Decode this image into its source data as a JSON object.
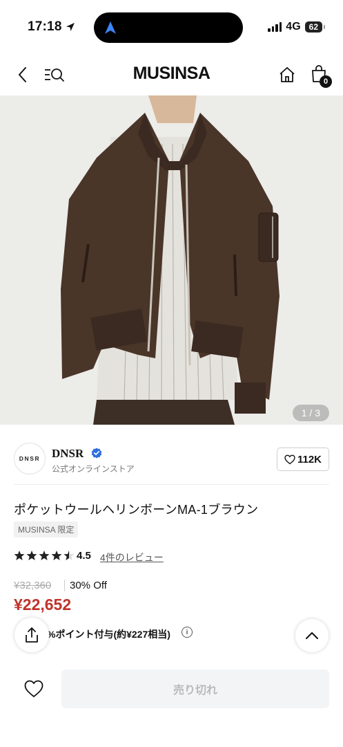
{
  "status_bar": {
    "time": "17:18",
    "network": "4G",
    "battery": "62"
  },
  "header": {
    "logo": "MUSINSA",
    "cart_count": "0",
    "icons": [
      "back-arrow-icon",
      "menu-search-icon",
      "home-icon",
      "cart-icon"
    ]
  },
  "gallery": {
    "counter": "1 / 3",
    "current": 1,
    "total": 3
  },
  "brand": {
    "logo_text": "DNSR",
    "name": "DNSR",
    "subtitle": "公式オンラインストア",
    "likes": "112K"
  },
  "product": {
    "title": "ポケットウールヘリンボーンMA-1ブラウン",
    "tag": "MUSINSA 限定",
    "rating": "4.5",
    "rating_stars": 4.5,
    "review_link": "4件のレビュー",
    "original_price": "¥32,360",
    "discount": "30% Off",
    "sale_price": "¥22,652",
    "points": "%ポイント付与(約¥227相当)"
  },
  "actions": {
    "soldout_label": "売り切れ"
  },
  "colors": {
    "sale_red": "#c0332b",
    "verified_blue": "#2f6fdf",
    "disabled_bg": "#f3f4f6"
  }
}
